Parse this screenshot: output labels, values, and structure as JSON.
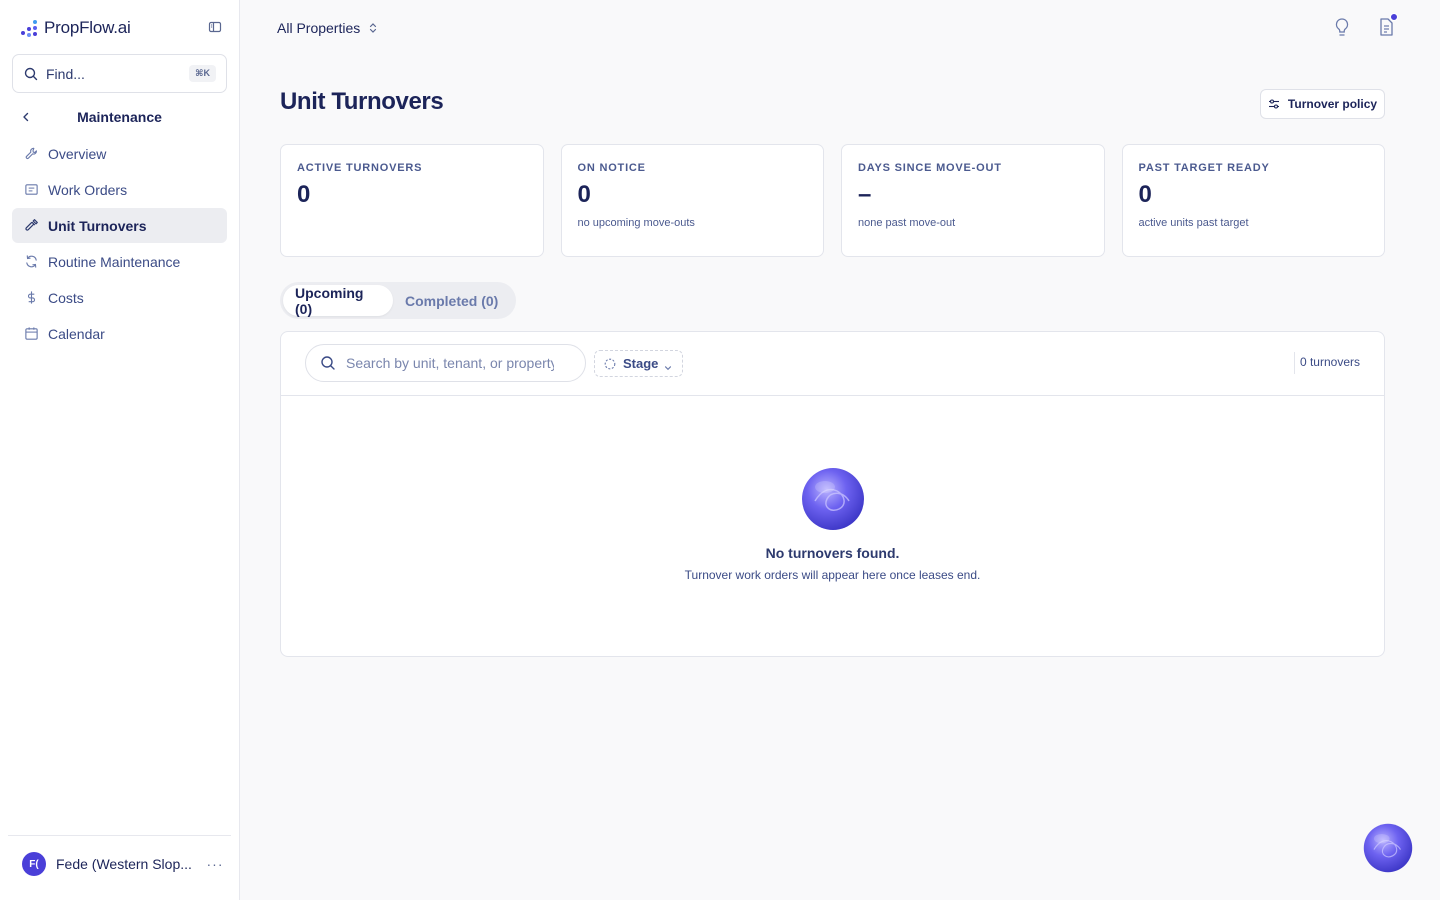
{
  "app": {
    "brand": "PropFlow.ai",
    "accent_color": "#4a3fd8"
  },
  "sidebar": {
    "find_placeholder": "Find...",
    "find_shortcut": "⌘K",
    "section_title": "Maintenance",
    "items": [
      {
        "label": "Overview",
        "icon": "wrench-icon",
        "active": false
      },
      {
        "label": "Work Orders",
        "icon": "clipboard-list-icon",
        "active": false
      },
      {
        "label": "Unit Turnovers",
        "icon": "hammer-icon",
        "active": true
      },
      {
        "label": "Routine Maintenance",
        "icon": "refresh-icon",
        "active": false
      },
      {
        "label": "Costs",
        "icon": "dollar-icon",
        "active": false
      },
      {
        "label": "Calendar",
        "icon": "calendar-icon",
        "active": false
      }
    ],
    "user": {
      "initials": "F(",
      "name": "Fede (Western Slop..."
    }
  },
  "topbar": {
    "property_selector": "All Properties"
  },
  "page": {
    "title": "Unit Turnovers",
    "policy_button": "Turnover policy"
  },
  "stats": [
    {
      "label": "ACTIVE TURNOVERS",
      "value": "0",
      "sub": ""
    },
    {
      "label": "ON NOTICE",
      "value": "0",
      "sub": "no upcoming move-outs"
    },
    {
      "label": "DAYS SINCE MOVE-OUT",
      "value": "–",
      "sub": "none past move-out"
    },
    {
      "label": "PAST TARGET READY",
      "value": "0",
      "sub": "active units past target"
    }
  ],
  "tabs": [
    {
      "label": "Upcoming (0)",
      "active": true
    },
    {
      "label": "Completed (0)",
      "active": false
    }
  ],
  "table": {
    "search_placeholder": "Search by unit, tenant, or property",
    "stage_filter": "Stage",
    "count": "0 turnovers",
    "empty_title": "No turnovers found.",
    "empty_subtitle": "Turnover work orders will appear here once leases end."
  }
}
